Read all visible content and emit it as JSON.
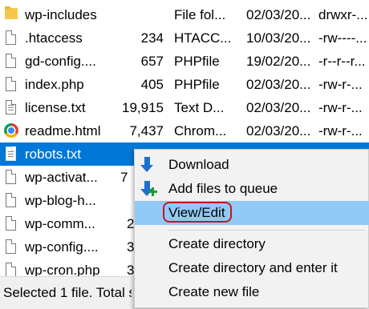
{
  "files": [
    {
      "icon": "folder-icon",
      "name": "wp-includes",
      "size": "",
      "type": "File fol...",
      "date": "02/03/20...",
      "perms": "drwxr-..."
    },
    {
      "icon": "file-icon",
      "name": ".htaccess",
      "size": "234",
      "type": "HTACC...",
      "date": "10/03/20...",
      "perms": "-rw----..."
    },
    {
      "icon": "file-icon",
      "name": "gd-config....",
      "size": "657",
      "type": "PHPfile",
      "date": "19/02/20...",
      "perms": "-r--r--r..."
    },
    {
      "icon": "file-icon",
      "name": "index.php",
      "size": "405",
      "type": "PHPfile",
      "date": "02/03/20...",
      "perms": "-rw-r-..."
    },
    {
      "icon": "text-file-icon",
      "name": "license.txt",
      "size": "19,915",
      "type": "Text D...",
      "date": "02/03/20...",
      "perms": "-rw-r-..."
    },
    {
      "icon": "chrome-icon",
      "name": "readme.html",
      "size": "7,437",
      "type": "Chrom...",
      "date": "02/03/20...",
      "perms": "-rw-r-..."
    },
    {
      "icon": "text-file-icon",
      "name": "robots.txt",
      "size": "",
      "type": "",
      "date": "",
      "perms": "",
      "selected": true
    },
    {
      "icon": "file-icon",
      "name": "wp-activat...",
      "size": "7",
      "type": "",
      "date": "",
      "perms": ""
    },
    {
      "icon": "file-icon",
      "name": "wp-blog-h...",
      "size": "",
      "type": "",
      "date": "",
      "perms": ""
    },
    {
      "icon": "file-icon",
      "name": "wp-comm...",
      "size": "2",
      "type": "",
      "date": "",
      "perms": ""
    },
    {
      "icon": "file-icon",
      "name": "wp-config....",
      "size": "3",
      "type": "",
      "date": "",
      "perms": ""
    },
    {
      "icon": "file-icon",
      "name": "wp-cron.php",
      "size": "3",
      "type": "",
      "date": "",
      "perms": ""
    }
  ],
  "status": {
    "text": "Selected 1 file. Total s"
  },
  "context_menu": {
    "items": [
      {
        "label": "Download",
        "icon": "download-arrow-icon"
      },
      {
        "label": "Add files to queue",
        "icon": "add-to-queue-icon"
      },
      {
        "label": "View/Edit",
        "highlighted": true
      },
      {
        "label": "Create directory"
      },
      {
        "label": "Create directory and enter it"
      },
      {
        "label": "Create new file"
      }
    ]
  },
  "colors": {
    "selection": "#0078d7",
    "menu_highlight": "#91c9f7",
    "annotation_outline": "#c4161c"
  }
}
